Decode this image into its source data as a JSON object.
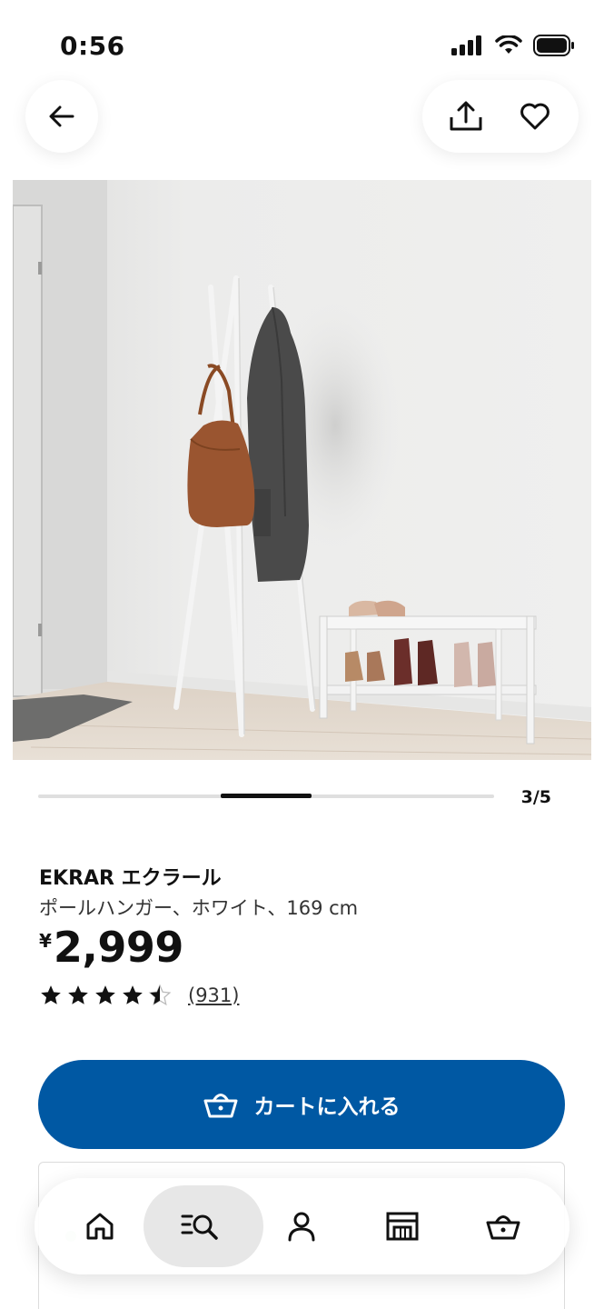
{
  "status": {
    "time": "0:56"
  },
  "carousel": {
    "counter": "3/5",
    "current": 3,
    "total": 5
  },
  "product": {
    "name": "EKRAR エクラール",
    "description": "ポールハンガー、ホワイト、169 cm",
    "price_currency": "¥",
    "price_value": "2,999",
    "rating": 4.5,
    "review_count": "(931)"
  },
  "cart_button": {
    "label": "カートに入れる"
  },
  "icons": {
    "back": "arrow-left-icon",
    "share": "share-icon",
    "favorite": "heart-icon",
    "home": "home-icon",
    "search": "search-list-icon",
    "profile": "person-icon",
    "store": "store-icon",
    "cart": "basket-icon"
  },
  "tab_bar": {
    "active": "search"
  },
  "colors": {
    "primary": "#0058a3",
    "active_tab": "#e7e7e7"
  }
}
